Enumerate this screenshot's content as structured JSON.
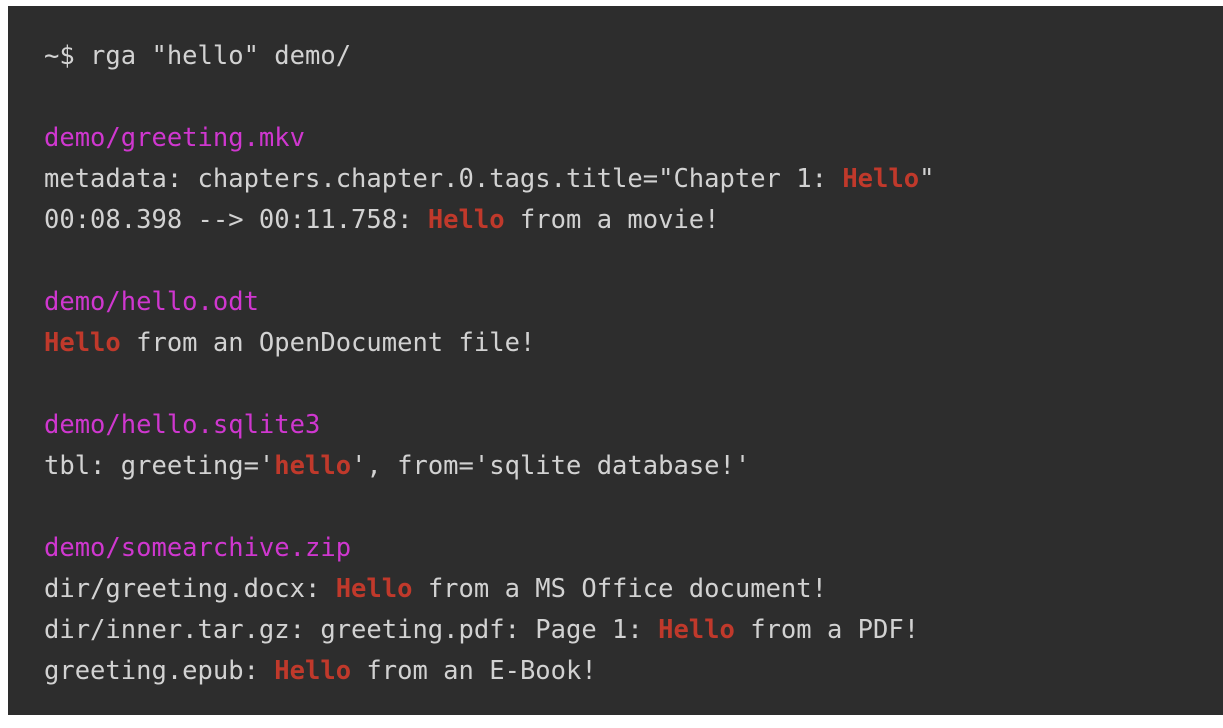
{
  "theme": {
    "page_background": "#ffffff",
    "terminal_background": "#2d2d2d",
    "foreground": "#d2d2d2",
    "path_color": "#cf37cf",
    "match_color": "#c0392b"
  },
  "terminal": {
    "prompt": "~$",
    "command": "rga \"hello\" demo/",
    "search_term": "hello",
    "search_path": "demo/",
    "program": "rga",
    "lines": [
      {
        "id": "command-line",
        "type": "command",
        "text": "~$ rga \"hello\" demo/",
        "segments": [
          {
            "kind": "plain",
            "text": "~$ rga \"hello\" demo/"
          }
        ]
      },
      {
        "id": "blank-1",
        "type": "blank",
        "text": "",
        "segments": []
      },
      {
        "id": "file-header-1",
        "type": "file-header",
        "text": "demo/greeting.mkv",
        "segments": [
          {
            "kind": "path",
            "text": "demo/greeting.mkv"
          }
        ]
      },
      {
        "id": "result-1-1",
        "type": "result",
        "text": "metadata: chapters.chapter.0.tags.title=\"Chapter 1: Hello\"",
        "segments": [
          {
            "kind": "plain",
            "text": "metadata: chapters.chapter.0.tags.title=\"Chapter 1: "
          },
          {
            "kind": "match",
            "text": "Hello"
          },
          {
            "kind": "plain",
            "text": "\""
          }
        ]
      },
      {
        "id": "result-1-2",
        "type": "result",
        "text": "00:08.398 --> 00:11.758: Hello from a movie!",
        "segments": [
          {
            "kind": "plain",
            "text": "00:08.398 --> 00:11.758: "
          },
          {
            "kind": "match",
            "text": "Hello"
          },
          {
            "kind": "plain",
            "text": " from a movie!"
          }
        ]
      },
      {
        "id": "blank-2",
        "type": "blank",
        "text": "",
        "segments": []
      },
      {
        "id": "file-header-2",
        "type": "file-header",
        "text": "demo/hello.odt",
        "segments": [
          {
            "kind": "path",
            "text": "demo/hello.odt"
          }
        ]
      },
      {
        "id": "result-2-1",
        "type": "result",
        "text": "Hello from an OpenDocument file!",
        "segments": [
          {
            "kind": "match",
            "text": "Hello"
          },
          {
            "kind": "plain",
            "text": " from an OpenDocument file!"
          }
        ]
      },
      {
        "id": "blank-3",
        "type": "blank",
        "text": "",
        "segments": []
      },
      {
        "id": "file-header-3",
        "type": "file-header",
        "text": "demo/hello.sqlite3",
        "segments": [
          {
            "kind": "path",
            "text": "demo/hello.sqlite3"
          }
        ]
      },
      {
        "id": "result-3-1",
        "type": "result",
        "text": "tbl: greeting='hello', from='sqlite database!'",
        "segments": [
          {
            "kind": "plain",
            "text": "tbl: greeting='"
          },
          {
            "kind": "match",
            "text": "hello"
          },
          {
            "kind": "plain",
            "text": "', from='sqlite database!'"
          }
        ]
      },
      {
        "id": "blank-4",
        "type": "blank",
        "text": "",
        "segments": []
      },
      {
        "id": "file-header-4",
        "type": "file-header",
        "text": "demo/somearchive.zip",
        "segments": [
          {
            "kind": "path",
            "text": "demo/somearchive.zip"
          }
        ]
      },
      {
        "id": "result-4-1",
        "type": "result",
        "text": "dir/greeting.docx: Hello from a MS Office document!",
        "segments": [
          {
            "kind": "plain",
            "text": "dir/greeting.docx: "
          },
          {
            "kind": "match",
            "text": "Hello"
          },
          {
            "kind": "plain",
            "text": " from a MS Office document!"
          }
        ]
      },
      {
        "id": "result-4-2",
        "type": "result",
        "text": "dir/inner.tar.gz: greeting.pdf: Page 1: Hello from a PDF!",
        "segments": [
          {
            "kind": "plain",
            "text": "dir/inner.tar.gz: greeting.pdf: Page 1: "
          },
          {
            "kind": "match",
            "text": "Hello"
          },
          {
            "kind": "plain",
            "text": " from a PDF!"
          }
        ]
      },
      {
        "id": "result-4-3",
        "type": "result",
        "text": "greeting.epub: Hello from an E-Book!",
        "segments": [
          {
            "kind": "plain",
            "text": "greeting.epub: "
          },
          {
            "kind": "match",
            "text": "Hello"
          },
          {
            "kind": "plain",
            "text": " from an E-Book!"
          }
        ]
      }
    ]
  }
}
